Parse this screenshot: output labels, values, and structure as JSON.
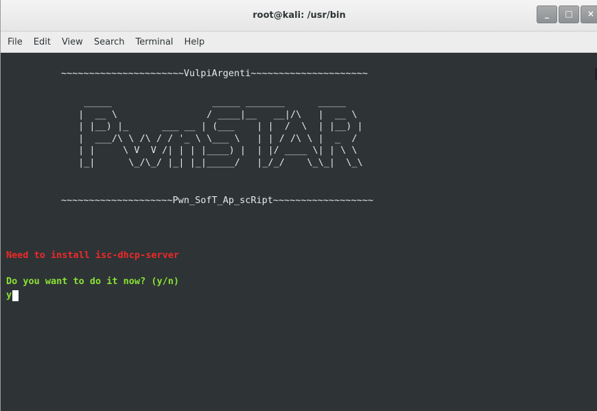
{
  "window": {
    "title": "root@kali: /usr/bin",
    "controls": {
      "minimize": "_",
      "maximize": "□",
      "close": "×"
    }
  },
  "menubar": {
    "items": [
      "File",
      "Edit",
      "View",
      "Search",
      "Terminal",
      "Help"
    ]
  },
  "terminal": {
    "banner_top": "~~~~~~~~~~~~~~~~~~~~~~VulpiArgenti~~~~~~~~~~~~~~~~~~~~~",
    "ascii_art": "  _____                  _____ _______      _____\n |  __ \\                / ____|__   __|/\\   |  __ \\\n | |__) |_      ___ __ | (___    | |  /  \\  | |__) |\n |  ___/\\ \\ /\\ / / '_ \\ \\___ \\   | | / /\\ \\ |  _  /\n | |     \\ V  V /| | | |____) |  | |/ ____ \\| | \\ \\\n |_|      \\_/\\_/ |_| |_|_____/   |_/_/    \\_\\_|  \\_\\",
    "banner_bottom": "~~~~~~~~~~~~~~~~~~~~Pwn_SofT_Ap_scRipt~~~~~~~~~~~~~~~~~~",
    "error_message": "Need to install isc-dhcp-server",
    "prompt": "Do you want to do it now? (y/n)",
    "input_value": "y",
    "colors": {
      "background": "#2e3436",
      "error": "#ef2929",
      "prompt": "#8ae234",
      "text": "#e8e8e8"
    }
  }
}
